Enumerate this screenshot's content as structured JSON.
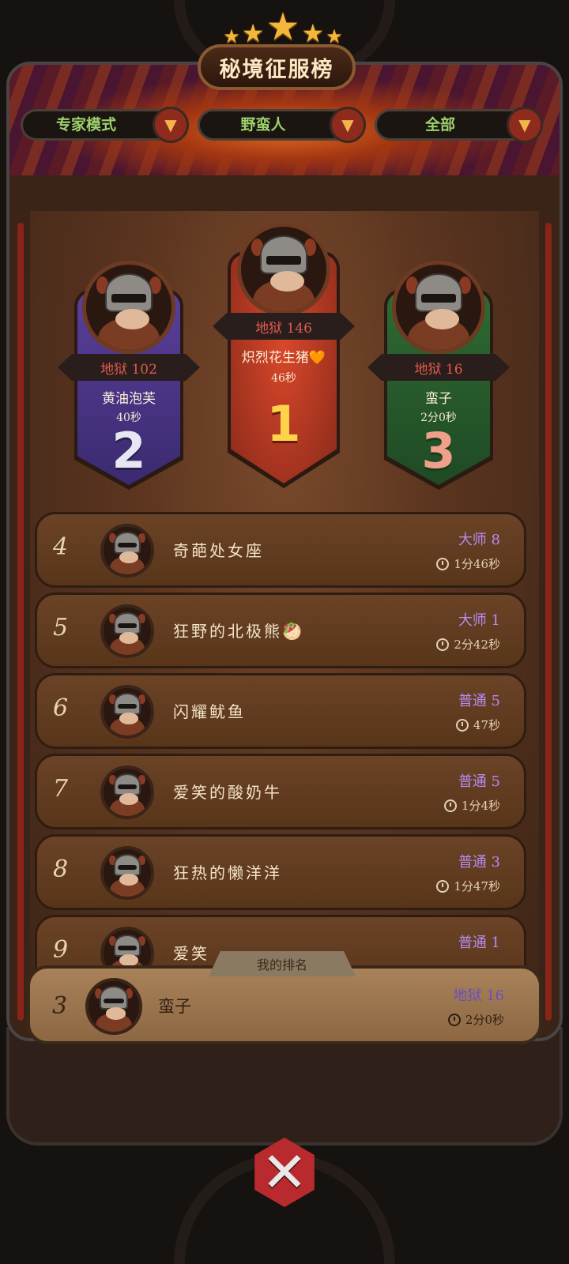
{
  "header": {
    "title": "秘境征服榜",
    "stars": 5
  },
  "filters": [
    {
      "label": "专家模式",
      "icon": "chevron-down-icon"
    },
    {
      "label": "野蛮人",
      "icon": "chevron-down-icon"
    },
    {
      "label": "全部",
      "icon": "chevron-down-icon"
    }
  ],
  "podium": {
    "first": {
      "rank": "1",
      "tier": "地狱 146",
      "name": "炽烈花生猪🧡",
      "time": "46秒"
    },
    "second": {
      "rank": "2",
      "tier": "地狱 102",
      "name": "黄油泡芙",
      "time": "40秒"
    },
    "third": {
      "rank": "3",
      "tier": "地狱 16",
      "name": "蛮子",
      "time": "2分0秒"
    }
  },
  "list": [
    {
      "rank": "4",
      "name": "奇葩处女座",
      "tier": "大师 8",
      "time": "1分46秒"
    },
    {
      "rank": "5",
      "name": "狂野的北极熊🥙",
      "tier": "大师 1",
      "time": "2分42秒"
    },
    {
      "rank": "6",
      "name": "闪耀鱿鱼",
      "tier": "普通 5",
      "time": "47秒"
    },
    {
      "rank": "7",
      "name": "爱笑的酸奶牛",
      "tier": "普通 5",
      "time": "1分4秒"
    },
    {
      "rank": "8",
      "name": "狂热的懒洋洋",
      "tier": "普通 3",
      "time": "1分47秒"
    },
    {
      "rank": "9",
      "name": "爱笑",
      "tier": "普通 1",
      "time": ""
    }
  ],
  "my_rank": {
    "tab_label": "我的排名",
    "rank": "3",
    "name": "蛮子",
    "tier": "地狱 16",
    "time": "2分0秒"
  },
  "close": {
    "icon": "close-icon"
  },
  "colors": {
    "accent_red": "#b92a2e",
    "tier_purple": "#b68cf2",
    "filter_green": "#9ed16a",
    "gold": "#f3b83a"
  }
}
